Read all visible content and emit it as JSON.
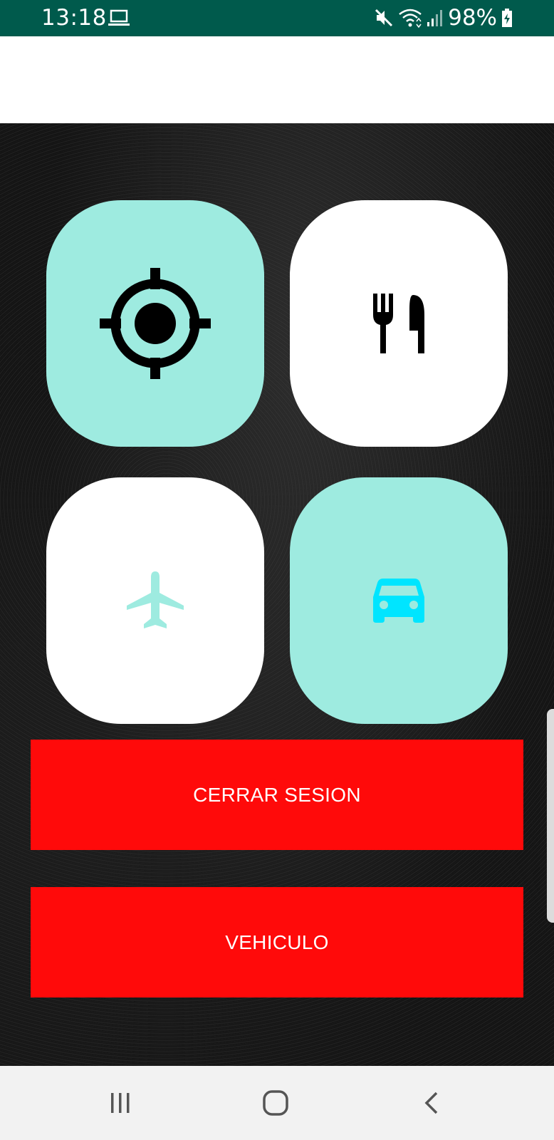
{
  "status_bar": {
    "time": "13:18",
    "battery": "98%",
    "background_color": "#005a4c"
  },
  "tiles": [
    {
      "name": "location",
      "icon": "gps-target-icon",
      "background": "#9eebe0",
      "icon_color": "#000000"
    },
    {
      "name": "restaurant",
      "icon": "fork-knife-icon",
      "background": "#ffffff",
      "icon_color": "#000000"
    },
    {
      "name": "flights",
      "icon": "airplane-icon",
      "background": "#ffffff",
      "icon_color": "#9eebe0"
    },
    {
      "name": "vehicle",
      "icon": "car-icon",
      "background": "#9eebe0",
      "icon_color": "#00e5ff"
    }
  ],
  "buttons": {
    "logout_label": "CERRAR SESION",
    "vehicle_label": "VEHICULO",
    "color": "#ff0a0a"
  },
  "nav_bar": {
    "icons": [
      "recents-icon",
      "home-icon",
      "back-icon"
    ]
  }
}
